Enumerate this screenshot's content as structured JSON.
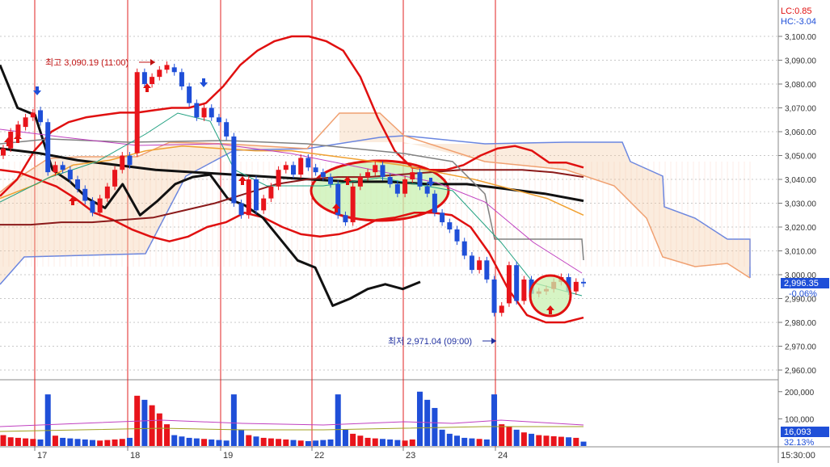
{
  "header": {
    "lc": "LC:0.85",
    "hc": "HC:-3.04"
  },
  "annotations": {
    "high": "최고 3,090.19 (11:00)",
    "low": "최저 2,971.04 (09:00)"
  },
  "price_badge": {
    "value": "2,996.35",
    "change": "-0.06%"
  },
  "volume_badge": {
    "value": "16,093",
    "pct": "32.13%"
  },
  "time_label": "15:30:00",
  "colors": {
    "up": "#e8141b",
    "down": "#1f4fd8",
    "ma_red": "#e01010",
    "ma_black": "#111111",
    "ma_orange": "#f0a030",
    "ma_brown": "#8b1a1a",
    "gray": "#808080",
    "ichimoku_blue": "#6a86e0",
    "ichimoku_orange": "#f0a070",
    "highlight": "#c8f0b0"
  },
  "chart_data": [
    {
      "type": "candlestick",
      "title": "",
      "ylim": [
        2955,
        3105
      ],
      "y_ticks": [
        "3,100.00",
        "3,090.00",
        "3,080.00",
        "3,070.00",
        "3,060.00",
        "3,050.00",
        "3,040.00",
        "3,030.00",
        "3,020.00",
        "3,010.00",
        "3,000.00",
        "2,990.00",
        "2,980.00",
        "2,970.00",
        "2,960.00"
      ],
      "x_categories": [
        "17",
        "18",
        "19",
        "22",
        "23",
        "24"
      ],
      "last_price": 2996.35,
      "high": 3090.19,
      "low": 2971.04,
      "candles": [
        {
          "o": 3050,
          "c": 3053
        },
        {
          "o": 3053,
          "c": 3060
        },
        {
          "o": 3058,
          "c": 3063
        },
        {
          "o": 3062,
          "c": 3066
        },
        {
          "o": 3066,
          "c": 3068
        },
        {
          "o": 3069,
          "c": 3064
        },
        {
          "o": 3064,
          "c": 3043
        },
        {
          "o": 3043,
          "c": 3046
        },
        {
          "o": 3046,
          "c": 3044
        },
        {
          "o": 3044,
          "c": 3040
        },
        {
          "o": 3040,
          "c": 3036
        },
        {
          "o": 3036,
          "c": 3031
        },
        {
          "o": 3031,
          "c": 3026
        },
        {
          "o": 3026,
          "c": 3032
        },
        {
          "o": 3032,
          "c": 3037
        },
        {
          "o": 3037,
          "c": 3044
        },
        {
          "o": 3044,
          "c": 3050
        },
        {
          "o": 3050,
          "c": 3046
        },
        {
          "o": 3051,
          "c": 3085
        },
        {
          "o": 3085,
          "c": 3080
        },
        {
          "o": 3080,
          "c": 3083
        },
        {
          "o": 3083,
          "c": 3086
        },
        {
          "o": 3086,
          "c": 3088
        },
        {
          "o": 3087,
          "c": 3085
        },
        {
          "o": 3085,
          "c": 3079
        },
        {
          "o": 3079,
          "c": 3072
        },
        {
          "o": 3072,
          "c": 3066
        },
        {
          "o": 3066,
          "c": 3070
        },
        {
          "o": 3070,
          "c": 3066
        },
        {
          "o": 3066,
          "c": 3064
        },
        {
          "o": 3064,
          "c": 3058
        },
        {
          "o": 3058,
          "c": 3030
        },
        {
          "o": 3030,
          "c": 3025
        },
        {
          "o": 3025,
          "c": 3040
        },
        {
          "o": 3040,
          "c": 3027
        },
        {
          "o": 3027,
          "c": 3032
        },
        {
          "o": 3032,
          "c": 3037
        },
        {
          "o": 3037,
          "c": 3044
        },
        {
          "o": 3044,
          "c": 3046
        },
        {
          "o": 3046,
          "c": 3042
        },
        {
          "o": 3042,
          "c": 3049
        },
        {
          "o": 3049,
          "c": 3045
        },
        {
          "o": 3045,
          "c": 3043
        },
        {
          "o": 3043,
          "c": 3041
        },
        {
          "o": 3041,
          "c": 3038
        },
        {
          "o": 3038,
          "c": 3025
        },
        {
          "o": 3025,
          "c": 3022
        },
        {
          "o": 3022,
          "c": 3037
        },
        {
          "o": 3037,
          "c": 3041
        },
        {
          "o": 3041,
          "c": 3043
        },
        {
          "o": 3043,
          "c": 3046
        },
        {
          "o": 3046,
          "c": 3041
        },
        {
          "o": 3041,
          "c": 3038
        },
        {
          "o": 3038,
          "c": 3034
        },
        {
          "o": 3034,
          "c": 3040
        },
        {
          "o": 3040,
          "c": 3043
        },
        {
          "o": 3043,
          "c": 3037
        },
        {
          "o": 3037,
          "c": 3034
        },
        {
          "o": 3034,
          "c": 3026
        },
        {
          "o": 3026,
          "c": 3022
        },
        {
          "o": 3022,
          "c": 3019
        },
        {
          "o": 3019,
          "c": 3014
        },
        {
          "o": 3014,
          "c": 3008
        },
        {
          "o": 3008,
          "c": 3002
        },
        {
          "o": 3002,
          "c": 3006
        },
        {
          "o": 3006,
          "c": 2998
        },
        {
          "o": 2998,
          "c": 2984
        },
        {
          "o": 2984,
          "c": 2987
        },
        {
          "o": 2988,
          "c": 3004
        },
        {
          "o": 3004,
          "c": 2989
        },
        {
          "o": 2989,
          "c": 2998
        },
        {
          "o": 2998,
          "c": 2992
        },
        {
          "o": 2992,
          "c": 2993
        },
        {
          "o": 2993,
          "c": 2994
        },
        {
          "o": 2994,
          "c": 2997
        },
        {
          "o": 2997,
          "c": 2999
        },
        {
          "o": 2999,
          "c": 2993
        },
        {
          "o": 2993,
          "c": 2997
        },
        {
          "o": 2997,
          "c": 2996.35
        }
      ],
      "lines": [
        {
          "name": "",
          "color": "#e01010",
          "width": 2.5,
          "y": [
            3033,
            3040,
            3052,
            3060,
            3064,
            3066,
            3067,
            3068,
            3068,
            3069,
            3070,
            3070,
            3072,
            3079,
            3088,
            3094,
            3098,
            3100,
            3100,
            3098,
            3094,
            3083,
            3066,
            3052,
            3045,
            3044,
            3044,
            3046,
            3050,
            3053,
            3054,
            3052,
            3047,
            3047,
            3045
          ]
        },
        {
          "name": "",
          "color": "#e01010",
          "width": 2.5,
          "y": [
            3044,
            3043,
            3040,
            3037,
            3032,
            3026,
            3023,
            3019,
            3016,
            3014,
            3016,
            3020,
            3022,
            3026,
            3024,
            3020,
            3017,
            3016,
            3017,
            3019,
            3023,
            3024,
            3026,
            3026,
            3025,
            3020,
            3009,
            2994,
            2983,
            2980,
            2980,
            2982
          ]
        },
        {
          "name": "",
          "color": "#111111",
          "width": 3,
          "y": [
            3088,
            3070,
            3067,
            3044,
            3039,
            3032,
            3028,
            3038,
            3025,
            3031,
            3038,
            3041,
            3042,
            3032,
            3029,
            3024,
            3015,
            3006,
            3003,
            2987,
            2990,
            2994,
            2996,
            2994,
            2997
          ]
        },
        {
          "name": "",
          "color": "#111111",
          "width": 3,
          "y": [
            3053,
            3051,
            3048,
            3046,
            3044,
            3043,
            3042,
            3041,
            3040,
            3039,
            3039,
            3038,
            3038,
            3036,
            3034,
            3031
          ]
        },
        {
          "name": "",
          "color": "#8b1a1a",
          "width": 2,
          "y": [
            3021,
            3021,
            3022,
            3022,
            3023,
            3024,
            3027,
            3030,
            3034,
            3038,
            3040,
            3041,
            3041,
            3042,
            3043,
            3044,
            3044,
            3044,
            3043,
            3041
          ]
        },
        {
          "name": "",
          "color": "#f0a030",
          "width": 1.5,
          "y": [
            3032,
            3038,
            3046,
            3048,
            3052,
            3054,
            3053,
            3052,
            3052,
            3050,
            3048,
            3046,
            3043,
            3040,
            3036,
            3032,
            3025
          ]
        }
      ],
      "volume": {
        "ylim": [
          0,
          235000
        ],
        "y_ticks": [
          "200,000",
          "100,000"
        ],
        "last": 16093
      }
    }
  ]
}
